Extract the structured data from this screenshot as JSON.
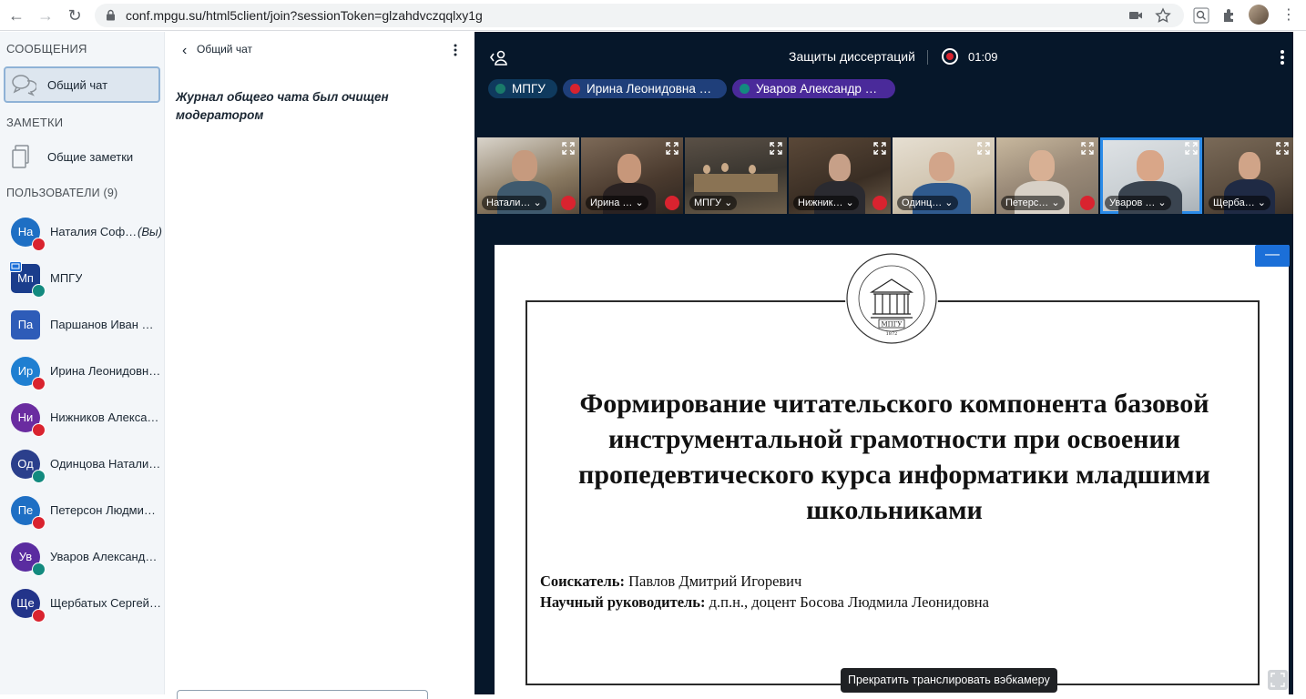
{
  "browser": {
    "url": "conf.mpgu.su/html5client/join?sessionToken=glzahdvczqqlxy1g"
  },
  "sidebar": {
    "messages_title": "СООБЩЕНИЯ",
    "public_chat_label": "Общий чат",
    "notes_title": "ЗАМЕТКИ",
    "shared_notes_label": "Общие заметки",
    "users_title": "ПОЛЬЗОВАТЕЛИ (9)",
    "users": [
      {
        "initials": "На",
        "name": "Наталия Соф…",
        "you_label": "(Вы)",
        "color": "#1e6fc4",
        "mic": "muted"
      },
      {
        "initials": "Мп",
        "name": "МПГУ",
        "color": "#1a3d8c",
        "mic": "on",
        "presenter": true
      },
      {
        "initials": "Па",
        "name": "Паршанов Иван А…",
        "color": "#2e5cb8",
        "mic": "none"
      },
      {
        "initials": "Ир",
        "name": "Ирина Леонидовн…",
        "color": "#1f7fd1",
        "mic": "muted"
      },
      {
        "initials": "Ни",
        "name": "Нижников Александ…",
        "color": "#6a2ca0",
        "mic": "muted"
      },
      {
        "initials": "Од",
        "name": "Одинцова Натали…",
        "color": "#2b3f8c",
        "mic": "on"
      },
      {
        "initials": "Пе",
        "name": "Петерсон Людмил…",
        "color": "#1e6fc4",
        "mic": "muted"
      },
      {
        "initials": "Ув",
        "name": "Уваров Александр…",
        "color": "#5a2ca0",
        "mic": "on"
      },
      {
        "initials": "Ще",
        "name": "Щербатых Сергей …",
        "color": "#23348a",
        "mic": "muted"
      }
    ]
  },
  "chat": {
    "title": "Общий чат",
    "cleared_message": "Журнал общего чата был очищен модератором"
  },
  "meeting": {
    "title": "Защиты диссертаций",
    "recording_time": "01:09",
    "talkers": [
      {
        "name": "МПГУ",
        "color": "#0f3a5e",
        "dot": "#1a7a6a"
      },
      {
        "name": "Ирина Леонидовна …",
        "color": "#1f3f7a",
        "dot": "#d9232f"
      },
      {
        "name": "Уваров Александр …",
        "color": "#4a2a9a",
        "dot": "#138a7f"
      }
    ],
    "videos": [
      {
        "label": "Натали… ⌄"
      },
      {
        "label": "Ирина … ⌄"
      },
      {
        "label": "МПГУ ⌄"
      },
      {
        "label": "Нижник… ⌄"
      },
      {
        "label": "Одинц… ⌄"
      },
      {
        "label": "Петерс… ⌄"
      },
      {
        "label": "Уваров … ⌄"
      },
      {
        "label": "Щерба… ⌄"
      }
    ]
  },
  "slide": {
    "heading": "Формирование читательского компонента базовой инструментальной грамотности при освоении пропедевтического курса информатики младшими школьниками",
    "applicant_label": "Соискатель:",
    "applicant_value": "Павлов Дмитрий Игоревич",
    "advisor_label": "Научный руководитель:",
    "advisor_value": "д.п.н., доцент Босова Людмила Леонидовна",
    "seal_text": "МПГУ",
    "seal_year": "1872"
  },
  "tooltip": "Прекратить транслировать вэбкамеру"
}
